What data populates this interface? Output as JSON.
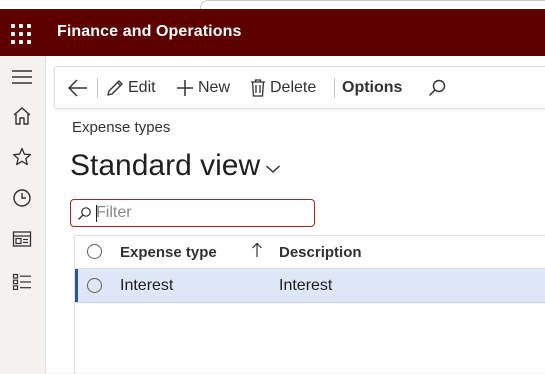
{
  "app": {
    "title": "Finance and Operations"
  },
  "nav": {
    "items": [
      {
        "icon": "hamburger-icon"
      },
      {
        "icon": "home-icon"
      },
      {
        "icon": "star-icon"
      },
      {
        "icon": "clock-icon"
      },
      {
        "icon": "workspace-icon"
      },
      {
        "icon": "module-list-icon"
      }
    ]
  },
  "toolbar": {
    "back_icon": "back-arrow-icon",
    "edit_label": "Edit",
    "new_label": "New",
    "delete_label": "Delete",
    "options_label": "Options",
    "search_icon": "search-icon"
  },
  "page": {
    "caption": "Expense types",
    "view_title": "Standard view"
  },
  "filter": {
    "placeholder": "Filter",
    "value": ""
  },
  "grid": {
    "columns": [
      "Expense type",
      "Description"
    ],
    "sort_column": "Expense type",
    "sort_direction": "ascending",
    "rows": [
      {
        "expense_type": "Interest",
        "description": "Interest",
        "selected": true
      }
    ]
  },
  "colors": {
    "app_bar": "#5c0000",
    "filter_border": "#a4262c",
    "selected_row": "#dde7f7",
    "row_accent": "#2b579a"
  }
}
